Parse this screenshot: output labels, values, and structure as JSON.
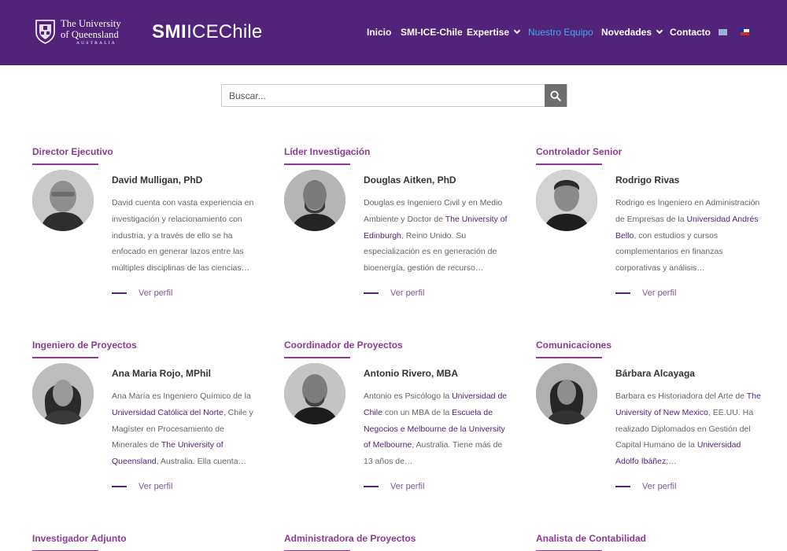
{
  "header": {
    "uq": {
      "line1": "The University",
      "line2": "of Queensland",
      "line3": "AUSTRALIA"
    },
    "site_logo": {
      "bold": "SMI",
      "light": "ICEChile"
    },
    "nav": [
      {
        "label": "Inicio",
        "dropdown": false,
        "active": false
      },
      {
        "label": "SMI-ICE-Chile",
        "dropdown": false,
        "active": false
      },
      {
        "label": "Expertise",
        "dropdown": true,
        "active": false
      },
      {
        "label": "Nuestro Equipo",
        "dropdown": false,
        "active": true
      },
      {
        "label": "Novedades",
        "dropdown": true,
        "active": false
      },
      {
        "label": "Contacto",
        "dropdown": false,
        "active": false
      }
    ],
    "flags": [
      "flag-en-icon",
      "flag-cl-icon"
    ],
    "colors": {
      "bar": "#51247a",
      "active": "#3fa9f5"
    }
  },
  "search": {
    "placeholder": "Buscar...",
    "value": "",
    "icon": "search-icon"
  },
  "team": [
    {
      "role": "Director Ejecutivo",
      "name": "David Mulligan, PhD",
      "desc": [
        {
          "t": "David cuenta con vasta experiencia en investigación y relacionamiento con industria, y a través de ello se ha enfocado en generar lazos entre las múltiples disciplinas de las ciencias…"
        }
      ],
      "more": "Ver perfil"
    },
    {
      "role": "Líder Investigación",
      "name": "Douglas Aitken, PhD",
      "desc": [
        {
          "t": "Douglas es Ingeniero Civil y en Medio Ambiente y Doctor de "
        },
        {
          "t": "The University of Edinburgh",
          "link": true
        },
        {
          "t": ", Reino Unido. Su especialización es en generación de bioenergía, gestión de recurso…"
        }
      ],
      "more": "Ver perfil"
    },
    {
      "role": "Controlador Senior",
      "name": "Rodrigo Rivas",
      "desc": [
        {
          "t": "Rodrigo es Ingeniero en Administración de Empresas de la "
        },
        {
          "t": "Universidad Andrés Bello",
          "link": true
        },
        {
          "t": ", con estudios y cursos complementarios en finanzas corporativas y análisis…"
        }
      ],
      "more": "Ver perfil"
    },
    {
      "role": "Ingeniero de Proyectos",
      "name": "Ana Maria Rojo, MPhil",
      "desc": [
        {
          "t": "Ana María es Ingeniero Químico de la "
        },
        {
          "t": "Universidad Católica del Norte",
          "link": true
        },
        {
          "t": ", Chile y Magíster en Procesamiento de Minerales de "
        },
        {
          "t": "The University of Queensland",
          "link": true
        },
        {
          "t": ", Australia. Ella cuenta…"
        }
      ],
      "more": "Ver perfil"
    },
    {
      "role": "Coordinador de Proyectos",
      "name": "Antonio Rivero, MBA",
      "desc": [
        {
          "t": "Antonio es Psicólogo la "
        },
        {
          "t": "Universidad de Chile",
          "link": true
        },
        {
          "t": " con un MBA de la "
        },
        {
          "t": "Escuela de Negocios e Melbourne de la University of Melbourne",
          "link": true
        },
        {
          "t": ", Australia. Tiene más de 13 años de…"
        }
      ],
      "more": "Ver perfil"
    },
    {
      "role": "Comunicaciones",
      "name": "Bárbara Alcayaga",
      "desc": [
        {
          "t": "Barbara es Historiadora del Arte de "
        },
        {
          "t": "The University of New Mexico",
          "link": true
        },
        {
          "t": ", EE.UU. Ha realizado Diplomados en Gestión del Capital Humano de la "
        },
        {
          "t": "Universidad Adolfo Ibáñez",
          "link": true
        },
        {
          "t": ";…"
        }
      ],
      "more": "Ver perfil"
    },
    {
      "role": "Investigador Adjunto"
    },
    {
      "role": "Administradora de Proyectos"
    },
    {
      "role": "Analista de Contabilidad"
    }
  ]
}
